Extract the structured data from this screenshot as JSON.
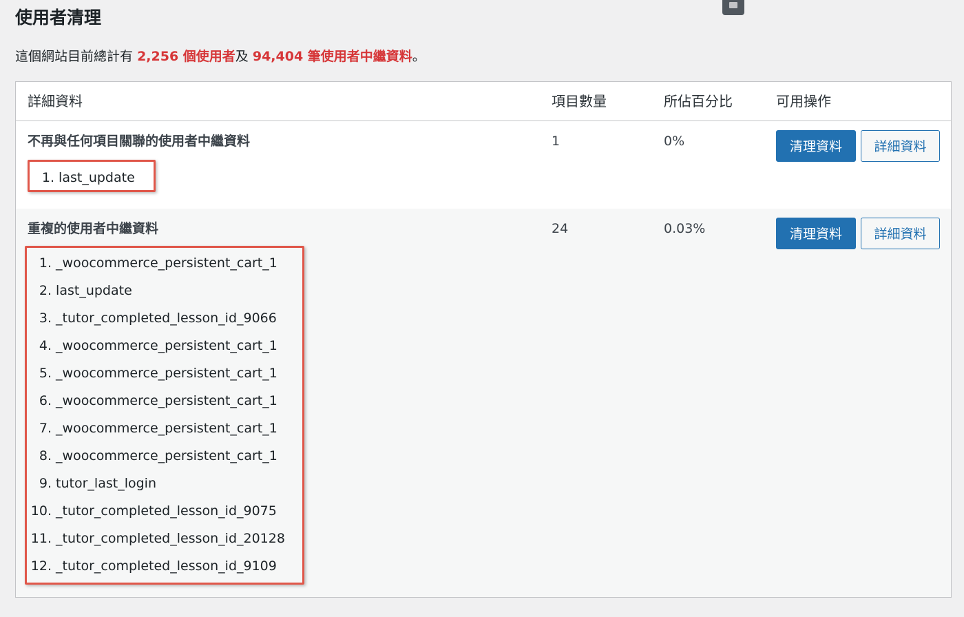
{
  "page": {
    "title": "使用者清理"
  },
  "summary": {
    "prefix": "這個網站目前總計有",
    "users_highlight": "2,256 個使用者",
    "middle": "及",
    "meta_highlight": "94,404 筆使用者中繼資料",
    "suffix": "。"
  },
  "table": {
    "headers": {
      "details": "詳細資料",
      "count": "項目數量",
      "percent": "所佔百分比",
      "actions": "可用操作"
    },
    "rows": [
      {
        "title": "不再與任何項目關聯的使用者中繼資料",
        "count": "1",
        "percent": "0%",
        "clean_label": "清理資料",
        "details_label": "詳細資料",
        "items": [
          {
            "num": "1.",
            "text": "last_update"
          }
        ]
      },
      {
        "title": "重複的使用者中繼資料",
        "count": "24",
        "percent": "0.03%",
        "clean_label": "清理資料",
        "details_label": "詳細資料",
        "items": [
          {
            "num": "1.",
            "text": "_woocommerce_persistent_cart_1"
          },
          {
            "num": "2.",
            "text": "last_update"
          },
          {
            "num": "3.",
            "text": "_tutor_completed_lesson_id_9066"
          },
          {
            "num": "4.",
            "text": "_woocommerce_persistent_cart_1"
          },
          {
            "num": "5.",
            "text": "_woocommerce_persistent_cart_1"
          },
          {
            "num": "6.",
            "text": "_woocommerce_persistent_cart_1"
          },
          {
            "num": "7.",
            "text": "_woocommerce_persistent_cart_1"
          },
          {
            "num": "8.",
            "text": "_woocommerce_persistent_cart_1"
          },
          {
            "num": "9.",
            "text": "tutor_last_login"
          },
          {
            "num": "10.",
            "text": "_tutor_completed_lesson_id_9075"
          },
          {
            "num": "11.",
            "text": "_tutor_completed_lesson_id_20128"
          },
          {
            "num": "12.",
            "text": "_tutor_completed_lesson_id_9109"
          }
        ]
      }
    ]
  },
  "colors": {
    "accent": "#2271b1",
    "highlight_text": "#d63638",
    "annotation_box": "#e0574a"
  },
  "icons": {
    "top_icon": "toolbar-icon"
  }
}
